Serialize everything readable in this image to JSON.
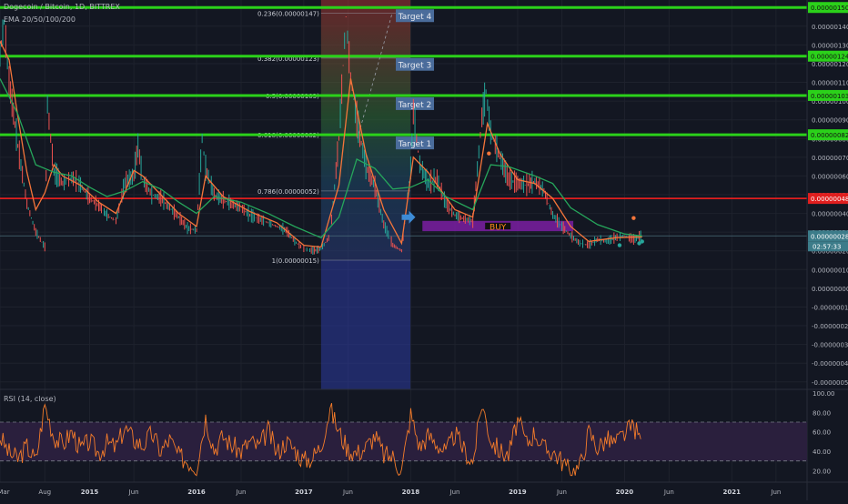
{
  "header": {
    "symbol": "Dogecoin / Bitcoin, 1D, BITTREX",
    "indicator": "EMA 20/50/100/200",
    "rsi_label": "RSI (14, close)"
  },
  "colors": {
    "background": "#131722",
    "grid": "#1e222d",
    "target_line": "#2bd11a",
    "buy_line": "#e01e1e",
    "buy_box": "#7b1fa2",
    "candle_up": "#26a69a",
    "candle_down": "#ef5350",
    "ema20": "#f5753a",
    "ema100": "#26a65b",
    "rsi_line": "#f57c2a",
    "rsi_band": "#2a1f3d",
    "target_box": "#4a6c9b",
    "axis_text": "#b2b5be",
    "fib_top": "#a83232",
    "fib_bottom": "#2c3aa0"
  },
  "chart_data": [
    {
      "type": "line",
      "title": "Dogecoin / Bitcoin, 1D, BITTREX",
      "yunit": "BTC",
      "ylim": [
        -5.4e-07,
        1.54e-06
      ],
      "xlim": [
        "2014-03-01",
        "2021-09-15"
      ],
      "x_ticks": [
        {
          "label": "Mar",
          "date": "2014-03-01"
        },
        {
          "label": "Aug",
          "date": "2014-08-01"
        },
        {
          "label": "2015",
          "date": "2015-01-01"
        },
        {
          "label": "Jun",
          "date": "2015-06-01"
        },
        {
          "label": "2016",
          "date": "2016-01-01"
        },
        {
          "label": "Jun",
          "date": "2016-06-01"
        },
        {
          "label": "2017",
          "date": "2017-01-01"
        },
        {
          "label": "Jun",
          "date": "2017-06-01"
        },
        {
          "label": "2018",
          "date": "2018-01-01"
        },
        {
          "label": "Jun",
          "date": "2018-06-01"
        },
        {
          "label": "2019",
          "date": "2019-01-01"
        },
        {
          "label": "Jun",
          "date": "2019-06-01"
        },
        {
          "label": "2020",
          "date": "2020-01-01"
        },
        {
          "label": "Jun",
          "date": "2020-06-01"
        },
        {
          "label": "2021",
          "date": "2021-01-01"
        },
        {
          "label": "Jun",
          "date": "2021-06-01"
        }
      ],
      "y_ticks": [
        "0.00000140",
        "0.00000130",
        "0.00000120",
        "0.00000110",
        "0.00000100",
        "0.00000090",
        "0.00000080",
        "0.00000070",
        "0.00000060",
        "0.00000050",
        "0.00000040",
        "0.00000030",
        "0.00000020",
        "0.00000010",
        "0.00000000",
        "-0.00000010",
        "-0.00000020",
        "-0.00000030",
        "-0.00000040",
        "-0.00000050"
      ],
      "y_tick_values": [
        1.4e-06,
        1.3e-06,
        1.2e-06,
        1.1e-06,
        1e-06,
        9e-07,
        8e-07,
        7e-07,
        6e-07,
        5e-07,
        4e-07,
        3e-07,
        2e-07,
        1e-07,
        0,
        -1e-07,
        -2e-07,
        -3e-07,
        -4e-07,
        -5e-07
      ],
      "price_labels": [
        {
          "text": "0.00000150",
          "value": 1.5e-06,
          "kind": "target"
        },
        {
          "text": "0.00000124",
          "value": 1.24e-06,
          "kind": "target"
        },
        {
          "text": "0.00000103",
          "value": 1.03e-06,
          "kind": "target"
        },
        {
          "text": "0.00000082",
          "value": 8.2e-07,
          "kind": "target"
        },
        {
          "text": "0.00000048",
          "value": 4.8e-07,
          "kind": "buy"
        },
        {
          "text": "0.00000028",
          "value": 2.8e-07,
          "kind": "last"
        }
      ],
      "countdown": "02:57:33",
      "horizontal_lines": [
        {
          "value": 1.5e-06,
          "kind": "target"
        },
        {
          "value": 1.24e-06,
          "kind": "target"
        },
        {
          "value": 1.03e-06,
          "kind": "target"
        },
        {
          "value": 8.2e-07,
          "kind": "target"
        },
        {
          "value": 4.8e-07,
          "kind": "buy"
        },
        {
          "value": 2.8e-07,
          "kind": "last"
        }
      ],
      "targets": [
        {
          "label": "Target 4",
          "value": 1.5e-06
        },
        {
          "label": "Target 3",
          "value": 1.24e-06
        },
        {
          "label": "Target 2",
          "value": 1.03e-06
        },
        {
          "label": "Target 1",
          "value": 8.2e-07
        }
      ],
      "buy_zone": {
        "label": "BUY",
        "from": "2018-02-10",
        "to": "2019-07-10",
        "low": 3.05e-07,
        "high": 3.6e-07
      },
      "fib": {
        "from": "2017-03-01",
        "to": "2017-12-31",
        "levels": [
          {
            "label": "0.236(0.00000147)",
            "value": 1.47e-06
          },
          {
            "label": "0.382(0.00000123)",
            "value": 1.23e-06
          },
          {
            "label": "0.5(0.00000103)",
            "value": 1.03e-06
          },
          {
            "label": "0.618(0.00000082)",
            "value": 8.2e-07
          },
          {
            "label": "0.786(0.00000052)",
            "value": 5.2e-07
          },
          {
            "label": "1(0.00000015)",
            "value": 1.5e-07
          }
        ]
      },
      "arrow": {
        "date": "2017-12-20",
        "value": 3.8e-07
      },
      "price_series": {
        "name": "",
        "x": [
          "2014-03-01",
          "2014-03-15",
          "2014-04-01",
          "2014-05-01",
          "2014-06-01",
          "2014-07-01",
          "2014-08-01",
          "2014-08-10",
          "2014-09-01",
          "2014-10-01",
          "2014-11-01",
          "2014-12-01",
          "2015-01-01",
          "2015-02-01",
          "2015-03-01",
          "2015-04-01",
          "2015-05-01",
          "2015-06-01",
          "2015-06-15",
          "2015-07-01",
          "2015-08-01",
          "2015-09-01",
          "2015-10-01",
          "2015-11-01",
          "2015-12-01",
          "2016-01-01",
          "2016-01-20",
          "2016-02-01",
          "2016-03-01",
          "2016-04-01",
          "2016-05-01",
          "2016-06-01",
          "2016-07-01",
          "2016-08-01",
          "2016-09-01",
          "2016-10-01",
          "2016-11-01",
          "2016-12-01",
          "2017-01-01",
          "2017-02-01",
          "2017-03-01",
          "2017-04-01",
          "2017-05-01",
          "2017-05-25",
          "2017-06-10",
          "2017-07-01",
          "2017-08-01",
          "2017-09-01",
          "2017-10-01",
          "2017-11-01",
          "2017-12-01",
          "2018-01-01",
          "2018-01-10",
          "2018-02-01",
          "2018-03-01",
          "2018-04-01",
          "2018-05-01",
          "2018-06-01",
          "2018-07-01",
          "2018-08-01",
          "2018-09-01",
          "2018-09-15",
          "2018-10-01",
          "2018-11-01",
          "2018-12-01",
          "2019-01-01",
          "2019-02-01",
          "2019-03-01",
          "2019-04-01",
          "2019-05-01",
          "2019-06-01",
          "2019-07-01",
          "2019-08-01",
          "2019-09-01",
          "2019-10-01",
          "2019-11-01",
          "2019-12-01",
          "2020-01-01",
          "2020-02-01",
          "2020-03-01"
        ],
        "y": [
          1.25e-06,
          1.42e-06,
          1.1e-06,
          7.6e-07,
          4.5e-07,
          3e-07,
          2.2e-07,
          9.8e-07,
          6.2e-07,
          5.6e-07,
          5.9e-07,
          5.5e-07,
          4.8e-07,
          4.4e-07,
          3.9e-07,
          3.6e-07,
          5.6e-07,
          6e-07,
          7.6e-07,
          5.8e-07,
          5e-07,
          4.8e-07,
          4.3e-07,
          3.8e-07,
          3.2e-07,
          3.1e-07,
          8e-07,
          6.4e-07,
          5e-07,
          4.7e-07,
          4.5e-07,
          4.3e-07,
          3.9e-07,
          3.7e-07,
          3.5e-07,
          3.3e-07,
          3.1e-07,
          2.5e-07,
          2.1e-07,
          2e-07,
          2.1e-07,
          2.8e-07,
          8e-07,
          1.45e-06,
          1.12e-06,
          9e-07,
          6.5e-07,
          5.4e-07,
          3.4e-07,
          2.3e-07,
          2e-07,
          6.4e-07,
          9.4e-07,
          6.6e-07,
          5.6e-07,
          5.8e-07,
          4.5e-07,
          3.9e-07,
          3.7e-07,
          3.6e-07,
          9.1e-07,
          1.05e-06,
          8.3e-07,
          7e-07,
          5.8e-07,
          5.6e-07,
          5.5e-07,
          5.7e-07,
          5.2e-07,
          3.9e-07,
          3.3e-07,
          2.8e-07,
          2.4e-07,
          2.3e-07,
          2.6e-07,
          2.5e-07,
          2.7e-07,
          2.8e-07,
          2.6e-07,
          2.8e-07
        ]
      },
      "ema_series": [
        {
          "name": "",
          "color": "#f5753a",
          "x": [
            "2014-03-01",
            "2014-04-01",
            "2014-05-01",
            "2014-06-01",
            "2014-07-01",
            "2014-08-01",
            "2014-09-01",
            "2014-10-01",
            "2014-12-01",
            "2015-02-01",
            "2015-04-01",
            "2015-06-01",
            "2015-07-01",
            "2015-09-01",
            "2015-11-01",
            "2016-01-01",
            "2016-02-01",
            "2016-04-01",
            "2016-07-01",
            "2016-10-01",
            "2017-01-01",
            "2017-03-01",
            "2017-05-01",
            "2017-06-10",
            "2017-08-01",
            "2017-10-01",
            "2017-12-01",
            "2018-01-10",
            "2018-03-01",
            "2018-06-01",
            "2018-08-01",
            "2018-09-20",
            "2018-11-01",
            "2019-01-01",
            "2019-03-01",
            "2019-05-01",
            "2019-07-01",
            "2019-09-01",
            "2019-12-01",
            "2020-03-01"
          ],
          "y": [
            1.32e-06,
            1.22e-06,
            9.2e-07,
            6.2e-07,
            4.2e-07,
            5.1e-07,
            6.6e-07,
            6e-07,
            5.5e-07,
            4.6e-07,
            4e-07,
            6.3e-07,
            6e-07,
            5e-07,
            4e-07,
            3.3e-07,
            6e-07,
            4.9e-07,
            4.1e-07,
            3.5e-07,
            2.3e-07,
            2.2e-07,
            5.5e-07,
            1.12e-06,
            7.2e-07,
            4.2e-07,
            2.4e-07,
            7e-07,
            6.2e-07,
            4.2e-07,
            3.8e-07,
            8.8e-07,
            7.2e-07,
            5.8e-07,
            5.6e-07,
            4.8e-07,
            3.3e-07,
            2.5e-07,
            2.7e-07,
            2.75e-07
          ]
        },
        {
          "name": "",
          "color": "#26a65b",
          "x": [
            "2014-03-01",
            "2014-05-01",
            "2014-07-01",
            "2014-09-01",
            "2014-11-01",
            "2015-01-01",
            "2015-03-01",
            "2015-05-01",
            "2015-07-01",
            "2015-09-01",
            "2015-11-01",
            "2016-01-01",
            "2016-03-01",
            "2016-06-01",
            "2016-09-01",
            "2016-12-01",
            "2017-03-01",
            "2017-05-01",
            "2017-07-01",
            "2017-09-01",
            "2017-11-01",
            "2018-01-01",
            "2018-03-01",
            "2018-05-01",
            "2018-08-01",
            "2018-10-01",
            "2018-12-01",
            "2019-03-01",
            "2019-05-01",
            "2019-07-01",
            "2019-10-01",
            "2020-01-01",
            "2020-03-01"
          ],
          "y": [
            1.12e-06,
            9.3e-07,
            6.6e-07,
            6.2e-07,
            6e-07,
            5.4e-07,
            4.9e-07,
            5.2e-07,
            5.7e-07,
            5.3e-07,
            4.6e-07,
            4e-07,
            4.9e-07,
            4.6e-07,
            4e-07,
            3.3e-07,
            2.7e-07,
            3.8e-07,
            6.9e-07,
            6.4e-07,
            5.3e-07,
            5.4e-07,
            5.8e-07,
            4.9e-07,
            4.2e-07,
            6.6e-07,
            6.5e-07,
            6e-07,
            5.6e-07,
            4.3e-07,
            3.4e-07,
            2.9e-07,
            2.8e-07
          ]
        }
      ],
      "signal_markers": [
        {
          "date": "2018-09-25",
          "value": 7.2e-07,
          "color": "#f5753a"
        },
        {
          "date": "2020-02-01",
          "value": 3.75e-07,
          "color": "#f5753a"
        },
        {
          "date": "2019-12-15",
          "value": 2.3e-07,
          "color": "#26a69a"
        },
        {
          "date": "2020-02-20",
          "value": 2.4e-07,
          "color": "#26a69a"
        },
        {
          "date": "2020-03-01",
          "value": 2.5e-07,
          "color": "#26a69a"
        }
      ]
    },
    {
      "type": "line",
      "title": "RSI (14, close)",
      "ylim": [
        10,
        100
      ],
      "y_ticks": [
        "100.00",
        "80.00",
        "60.00",
        "40.00",
        "20.00"
      ],
      "y_tick_values": [
        100,
        80,
        60,
        40,
        20
      ],
      "bands": [
        30,
        70
      ],
      "series": [
        {
          "name": "",
          "x": [
            "2014-03-01",
            "2014-04-01",
            "2014-05-01",
            "2014-06-01",
            "2014-07-01",
            "2014-08-01",
            "2014-09-01",
            "2014-10-01",
            "2014-11-01",
            "2014-12-01",
            "2015-01-01",
            "2015-02-01",
            "2015-03-01",
            "2015-04-01",
            "2015-05-01",
            "2015-06-01",
            "2015-07-01",
            "2015-08-01",
            "2015-09-01",
            "2015-10-01",
            "2015-11-01",
            "2015-12-01",
            "2016-01-01",
            "2016-02-01",
            "2016-03-01",
            "2016-04-01",
            "2016-05-01",
            "2016-06-01",
            "2016-07-01",
            "2016-08-01",
            "2016-09-01",
            "2016-10-01",
            "2016-11-01",
            "2016-12-01",
            "2017-01-01",
            "2017-02-01",
            "2017-03-01",
            "2017-04-01",
            "2017-05-01",
            "2017-06-01",
            "2017-07-01",
            "2017-08-01",
            "2017-09-01",
            "2017-10-01",
            "2017-11-01",
            "2017-12-01",
            "2018-01-01",
            "2018-02-01",
            "2018-03-01",
            "2018-04-01",
            "2018-05-01",
            "2018-06-01",
            "2018-07-01",
            "2018-08-01",
            "2018-09-01",
            "2018-10-01",
            "2018-11-01",
            "2018-12-01",
            "2019-01-01",
            "2019-02-01",
            "2019-03-01",
            "2019-04-01",
            "2019-05-01",
            "2019-06-01",
            "2019-07-01",
            "2019-08-01",
            "2019-09-01",
            "2019-10-01",
            "2019-11-01",
            "2019-12-01",
            "2020-01-01",
            "2020-02-01",
            "2020-03-01"
          ],
          "y": [
            55,
            38,
            32,
            45,
            30,
            88,
            55,
            47,
            60,
            42,
            50,
            38,
            48,
            44,
            64,
            52,
            46,
            58,
            40,
            52,
            35,
            30,
            24,
            75,
            42,
            55,
            46,
            40,
            50,
            44,
            62,
            38,
            50,
            42,
            30,
            34,
            46,
            84,
            60,
            42,
            38,
            44,
            56,
            36,
            34,
            20,
            78,
            44,
            56,
            48,
            38,
            58,
            42,
            28,
            90,
            52,
            40,
            36,
            72,
            48,
            60,
            42,
            40,
            30,
            18,
            24,
            60,
            44,
            52,
            48,
            58,
            66,
            48
          ]
        }
      ]
    }
  ]
}
